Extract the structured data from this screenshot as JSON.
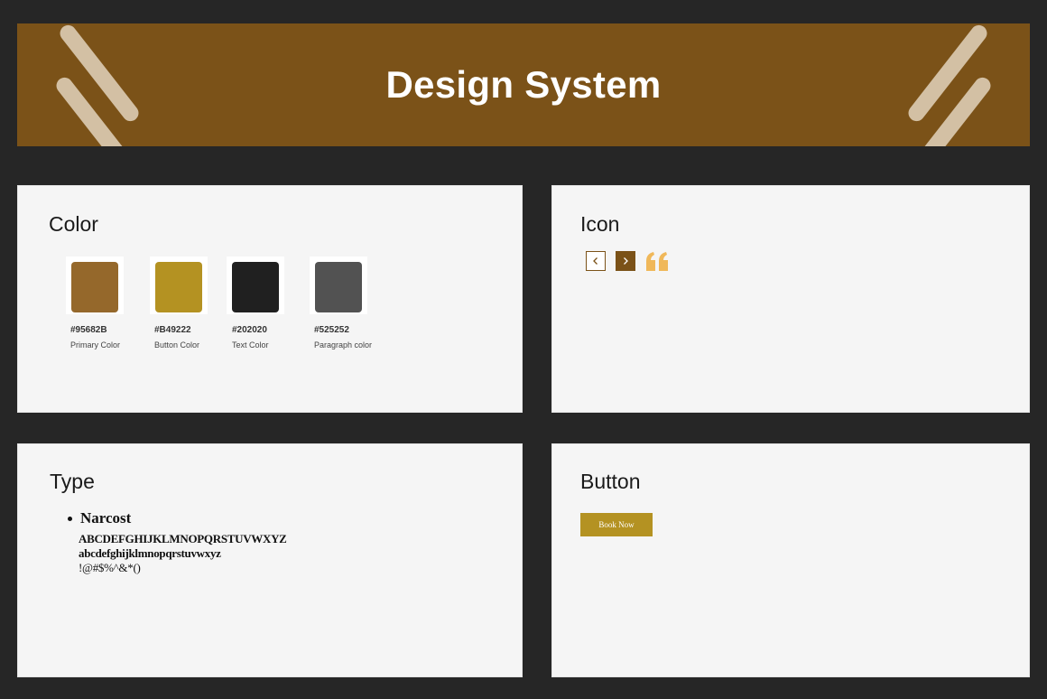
{
  "header": {
    "title": "Design System"
  },
  "color_section": {
    "title": "Color",
    "swatches": [
      {
        "hex": "#95682B",
        "name": "Primary Color",
        "color": "#95682b"
      },
      {
        "hex": "#B49222",
        "name": "Button Color",
        "color": "#b49222"
      },
      {
        "hex": "#202020",
        "name": "Text Color",
        "color": "#202020"
      },
      {
        "hex": "#525252",
        "name": "Paragraph color",
        "color": "#525252"
      }
    ]
  },
  "icon_section": {
    "title": "Icon",
    "icons": [
      "chevron-left-icon",
      "chevron-right-icon",
      "quote-icon"
    ],
    "icon_color": "#7b5218",
    "quote_color": "#f0b85a"
  },
  "type_section": {
    "title": "Type",
    "font_name": "Narcost",
    "uppercase": "ABCDEFGHIJKLMNOPQRSTUVWXYZ",
    "lowercase": "abcdefghijklmnopqrstuvwxyz",
    "symbols": "!@#$%^&*()"
  },
  "button_section": {
    "title": "Button",
    "button_label": "Book Now"
  }
}
